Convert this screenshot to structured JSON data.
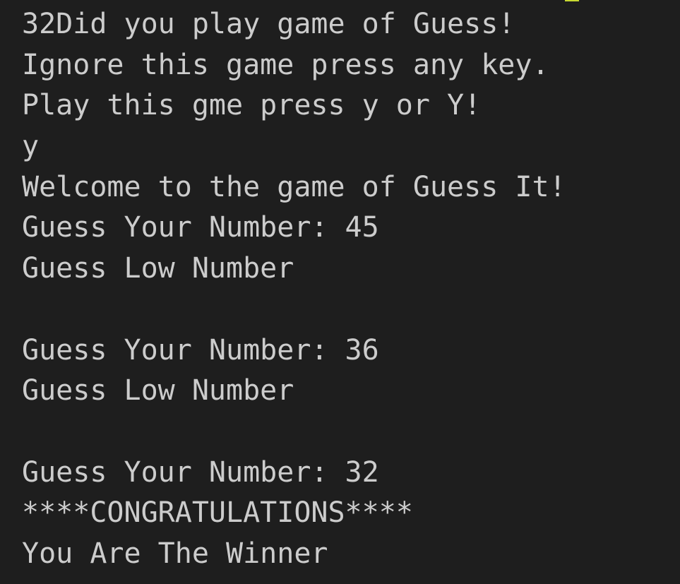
{
  "terminal": {
    "background": "#1e1e1e",
    "foreground": "#cccccc",
    "cursor_color": "#c8d831",
    "lines": [
      "32Did you play game of Guess!",
      "Ignore this game press any key.",
      "Play this gme press y or Y!",
      "y",
      "Welcome to the game of Guess It!",
      "Guess Your Number: 45",
      "Guess Low Number",
      "",
      "Guess Your Number: 36",
      "Guess Low Number",
      "",
      "Guess Your Number: 32",
      "****CONGRATULATIONS****",
      "You Are The Winner"
    ]
  }
}
